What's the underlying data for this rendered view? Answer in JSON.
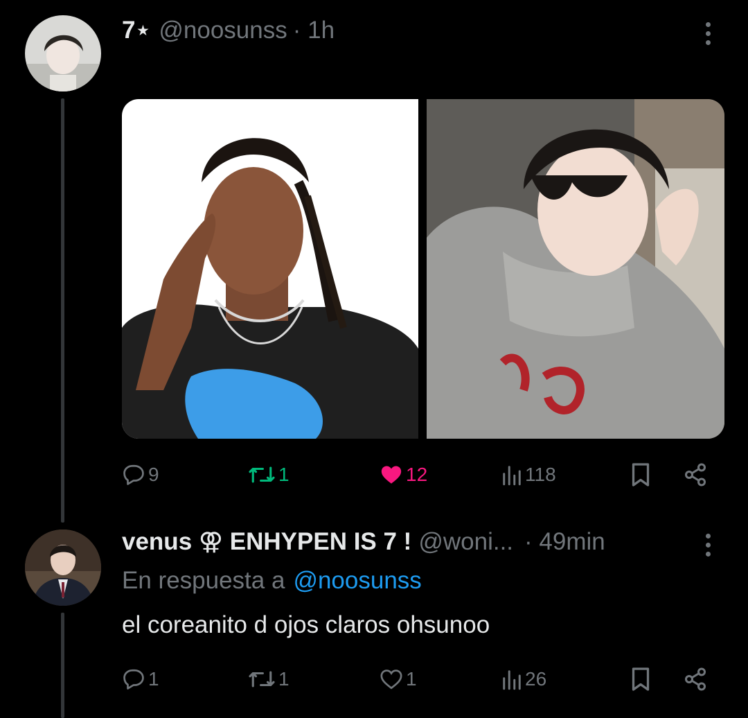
{
  "tweet": {
    "author_display": "7⋆",
    "handle": "@noosunss",
    "time": "· 1h",
    "metrics": {
      "replies": "9",
      "reposts": "1",
      "likes": "12",
      "views": "118"
    },
    "colors": {
      "repost_active": "#00ba7c",
      "like_active": "#f91880"
    }
  },
  "reply": {
    "author_display": "venus ⚢ ENHYPEN IS 7 !",
    "handle": "@woni...",
    "time": "· 49min",
    "replying_to_prefix": "En respuesta a",
    "replying_to_handle": "@noosunss",
    "text": "el coreanito d ojos claros ohsunoo",
    "metrics": {
      "replies": "1",
      "reposts": "1",
      "likes": "1",
      "views": "26"
    }
  },
  "icons": [
    "reply-icon",
    "repost-icon",
    "like-icon",
    "views-icon",
    "bookmark-icon",
    "share-icon",
    "more-icon"
  ],
  "theme": {
    "background": "#000000",
    "text": "#e7e9ea",
    "muted": "#71767b",
    "link": "#1d9bf0"
  }
}
